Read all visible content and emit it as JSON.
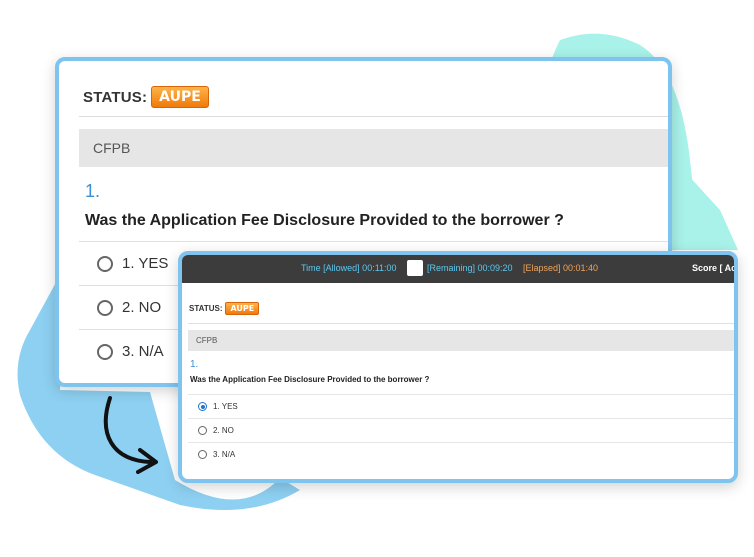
{
  "colors": {
    "accent_blue": "#3b8fd6",
    "badge_orange": "#f07a0c",
    "timer_bar": "#3c3c3c",
    "border_blue": "#7ec4ef",
    "bg_blob_blue": "#8ed0f2",
    "bg_blob_mint": "#a8f2ea"
  },
  "large": {
    "status_label": "STATUS:",
    "status_badge": "AUPE",
    "section_title": "CFPB",
    "question_number": "1.",
    "question_text": "Was the Application Fee Disclosure Provided to the borrower ?",
    "options": [
      "1. YES",
      "2. NO",
      "3. N/A"
    ]
  },
  "small": {
    "timer": {
      "allowed": "Time [Allowed] 00:11:00",
      "remaining": "[Remaining] 00:09:20",
      "elapsed": "[Elapsed] 00:01:40",
      "score": "Score [ Act"
    },
    "status_label": "STATUS:",
    "status_badge": "AUPE",
    "section_title": "CFPB",
    "question_number": "1.",
    "question_text": "Was the Application Fee Disclosure Provided to the borrower ?",
    "options": [
      "1. YES",
      "2. NO",
      "3. N/A"
    ],
    "selected_option": "1. YES"
  },
  "icons": {
    "radio": "radio-icon",
    "arrow": "curved-arrow-icon"
  }
}
